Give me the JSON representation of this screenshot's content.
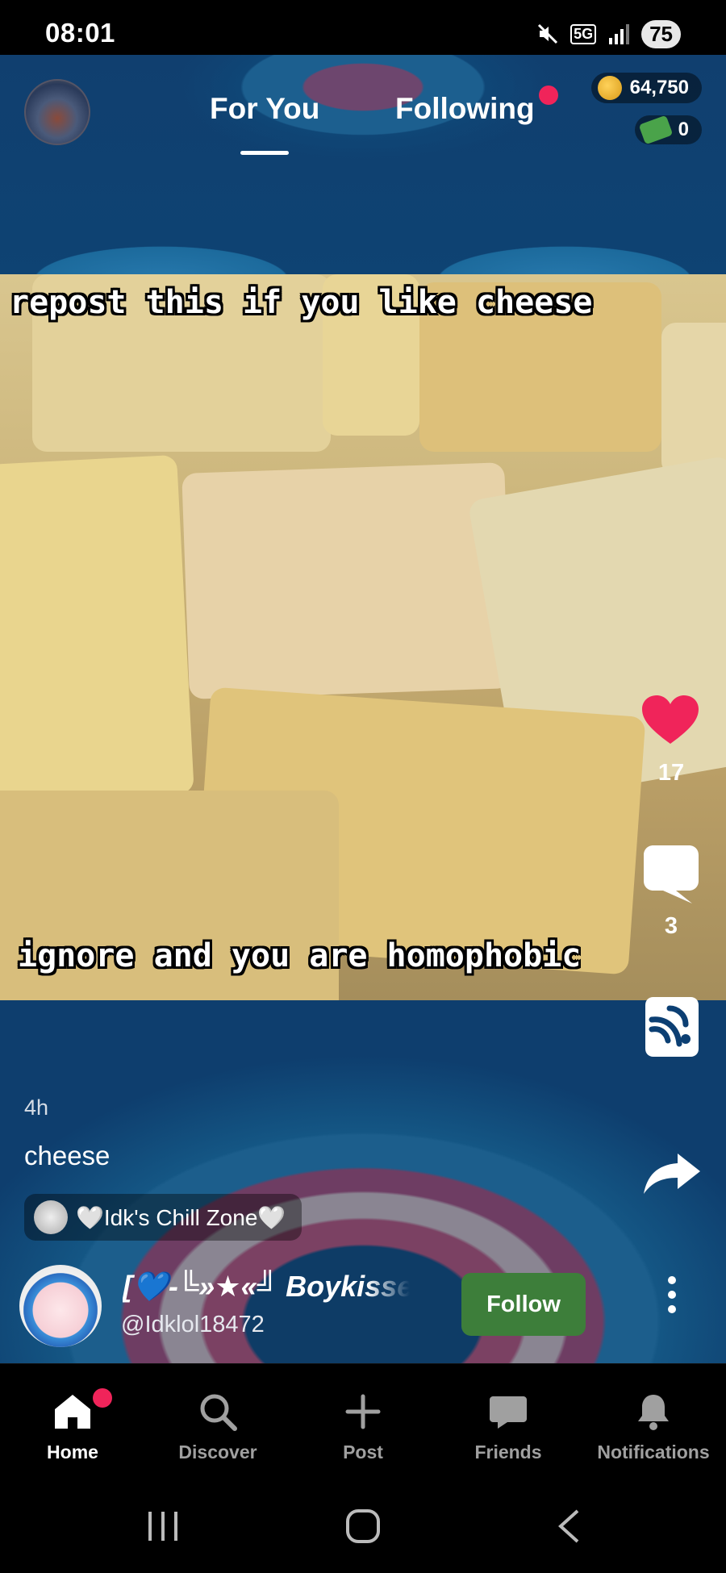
{
  "status_bar": {
    "time": "08:01",
    "network": "5G",
    "battery": "75"
  },
  "header": {
    "tabs": [
      {
        "label": "For You",
        "active": true
      },
      {
        "label": "Following",
        "active": false,
        "notification_dot": true
      }
    ],
    "coins": "64,750",
    "cash": "0"
  },
  "post": {
    "caption_top": "repost this if you like cheese",
    "caption_bottom": "ignore and you are homophobic",
    "likes": "17",
    "comments": "3",
    "time_ago": "4h",
    "description": "cheese",
    "community": "🤍Idk's Chill Zone🤍",
    "author_name": "[💙-╚»★«╝ Boykisser",
    "author_handle": "@Idklol18472",
    "follow_label": "Follow"
  },
  "bottom_nav": [
    {
      "label": "Home",
      "icon": "home-icon",
      "active": true,
      "badge": true
    },
    {
      "label": "Discover",
      "icon": "search-icon",
      "active": false
    },
    {
      "label": "Post",
      "icon": "plus-icon",
      "active": false
    },
    {
      "label": "Friends",
      "icon": "chat-icon",
      "active": false
    },
    {
      "label": "Notifications",
      "icon": "bell-icon",
      "active": false
    }
  ],
  "colors": {
    "accent_red": "#f0245a",
    "follow_green": "#3d7e3a",
    "background_blue": "#0c3f73"
  }
}
